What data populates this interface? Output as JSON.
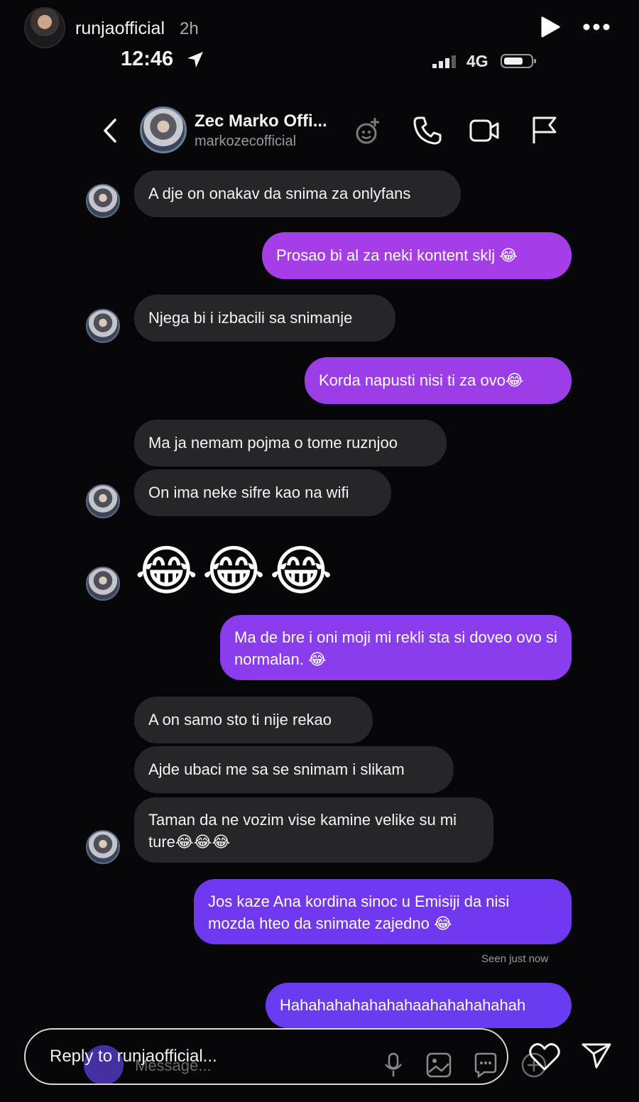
{
  "story": {
    "username": "runjaofficial",
    "time_ago": "2h"
  },
  "status_bar": {
    "time": "12:46",
    "network": "4G"
  },
  "chat_header": {
    "name": "Zec Marko Offi...",
    "handle": "markozecofficial",
    "icons": [
      "back-icon",
      "effects-icon",
      "phone-icon",
      "video-icon",
      "flag-icon"
    ]
  },
  "messages": [
    {
      "side": "in",
      "text": "A dje on onakav da snima za onlyfans"
    },
    {
      "side": "out",
      "text": "Prosao bi al za neki kontent sklj 😂"
    },
    {
      "side": "in",
      "text": "Njega bi i izbacili sa snimanje"
    },
    {
      "side": "out",
      "text": "Korda napusti nisi ti za ovo😂"
    },
    {
      "side": "in",
      "text": "Ma ja nemam pojma o tome ruznjoo"
    },
    {
      "side": "in",
      "text": "On ima neke sifre kao na wifi"
    },
    {
      "side": "in",
      "text": "😂😂😂"
    },
    {
      "side": "out",
      "text": "Ma de bre i oni moji mi rekli sta si doveo ovo si normalan. 😂"
    },
    {
      "side": "in",
      "text": "A on samo sto ti nije rekao"
    },
    {
      "side": "in",
      "text": "Ajde ubaci me sa se snimam i slikam"
    },
    {
      "side": "in",
      "text": "Taman da ne vozim vise kamine velike su mi ture😂😂😂"
    },
    {
      "side": "out",
      "text": "Jos kaze Ana kordina sinoc u Emisiji da nisi mozda hteo da snimate zajedno 😂"
    },
    {
      "side": "out",
      "text": "Hahahahahahahahaahahahahahah"
    }
  ],
  "seen_text": "Seen just now",
  "reply": {
    "placeholder": "Reply to runjaofficial...",
    "ghost_message": "Message..."
  },
  "colors": {
    "background": "#060609",
    "incoming_bubble": "#262629",
    "outgoing_purple": "#a63ee8",
    "outgoing_violet": "#6a3cf0"
  }
}
